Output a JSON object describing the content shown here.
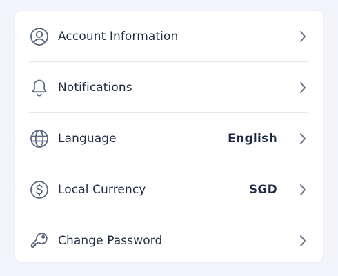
{
  "settings": {
    "items": [
      {
        "label": "Account Information",
        "icon": "user-circle-icon",
        "value": ""
      },
      {
        "label": "Notifications",
        "icon": "bell-icon",
        "value": ""
      },
      {
        "label": "Language",
        "icon": "globe-icon",
        "value": "English"
      },
      {
        "label": "Local Currency",
        "icon": "dollar-circle-icon",
        "value": "SGD"
      },
      {
        "label": "Change Password",
        "icon": "key-icon",
        "value": ""
      }
    ]
  },
  "colors": {
    "background": "#f4f5fa",
    "card": "#ffffff",
    "text": "#1f2a44",
    "icon": "#5c6880",
    "divider": "#e6e8ee"
  }
}
